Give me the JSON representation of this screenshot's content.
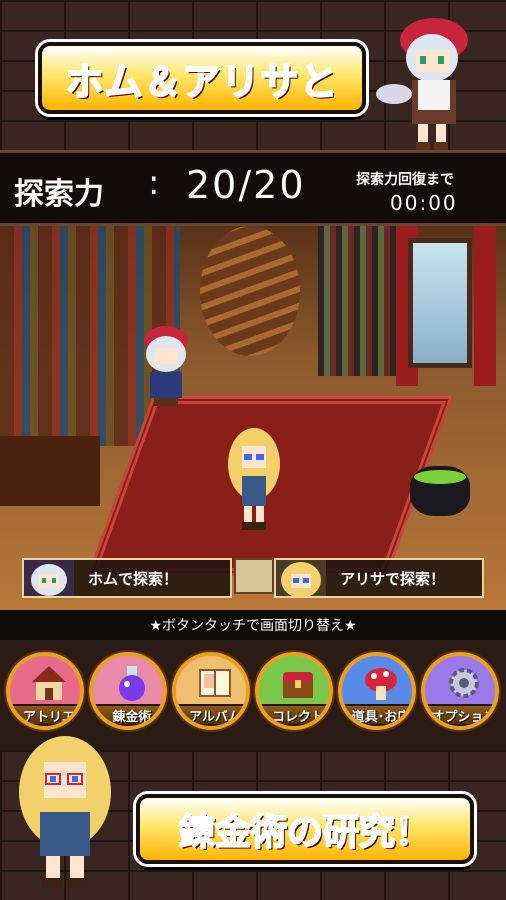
{
  "header": {
    "title": "ホム＆アリサと"
  },
  "stamina": {
    "label": "探索力",
    "colon": ":",
    "value": "20/20",
    "recover_label": "探索力回復まで",
    "recover_timer": "00:00"
  },
  "explore": {
    "hom_label": "ホムで探索！",
    "arisa_label": "アリサで探索！"
  },
  "hint": "★ボタンタッチで画面切り替え★",
  "menu": {
    "items": [
      {
        "label": "アトリエ",
        "icon": "house-icon",
        "color": "#e86a8a"
      },
      {
        "label": "錬金術",
        "icon": "potion-icon",
        "color": "#e88aa8"
      },
      {
        "label": "アルバム",
        "icon": "album-icon",
        "color": "#f0c070"
      },
      {
        "label": "コレクト",
        "icon": "chest-icon",
        "color": "#7ac84a"
      },
      {
        "label": "道具･お店",
        "icon": "mushroom-icon",
        "color": "#5a8ae8"
      },
      {
        "label": "オプション",
        "icon": "gear-icon",
        "color": "#9a7ae8"
      }
    ]
  },
  "footer": {
    "title": "錬金術の研究！"
  },
  "colors": {
    "banner_text": "#e0261c",
    "menu_border": "#e8a020",
    "bar_bg": "#120c0a"
  }
}
